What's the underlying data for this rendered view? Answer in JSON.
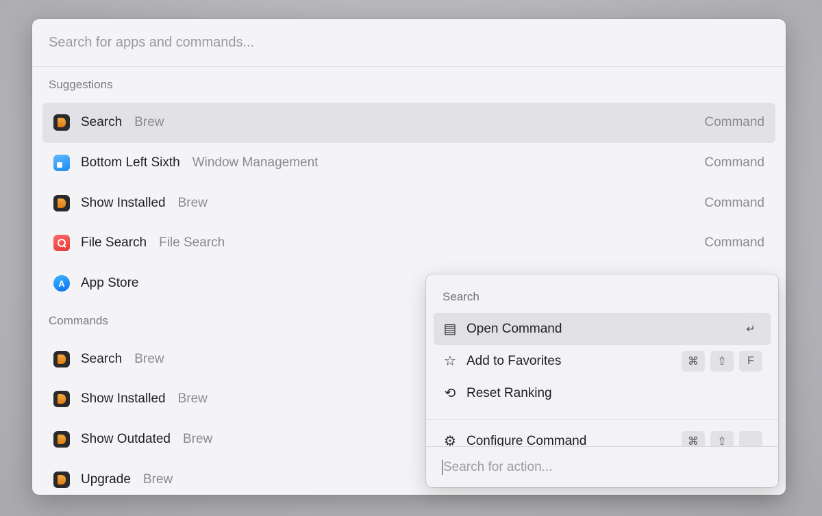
{
  "search": {
    "placeholder": "Search for apps and commands..."
  },
  "suggestions": {
    "title": "Suggestions",
    "items": [
      {
        "title": "Search",
        "subtitle": "Brew",
        "accessory": "Command",
        "icon": "brew-icon"
      },
      {
        "title": "Bottom Left Sixth",
        "subtitle": "Window Management",
        "accessory": "Command",
        "icon": "window-management-icon"
      },
      {
        "title": "Show Installed",
        "subtitle": "Brew",
        "accessory": "Command",
        "icon": "brew-icon"
      },
      {
        "title": "File Search",
        "subtitle": "File Search",
        "accessory": "Command",
        "icon": "file-search-icon"
      },
      {
        "title": "App Store",
        "subtitle": "",
        "accessory": "",
        "icon": "app-store-icon",
        "glyph": "A"
      }
    ]
  },
  "commands": {
    "title": "Commands",
    "items": [
      {
        "title": "Search",
        "subtitle": "Brew",
        "icon": "brew-icon"
      },
      {
        "title": "Show Installed",
        "subtitle": "Brew",
        "icon": "brew-icon"
      },
      {
        "title": "Show Outdated",
        "subtitle": "Brew",
        "icon": "brew-icon"
      },
      {
        "title": "Upgrade",
        "subtitle": "Brew",
        "icon": "brew-icon"
      }
    ]
  },
  "action_panel": {
    "title": "Search",
    "actions": [
      {
        "label": "Open Command",
        "icon": "list-icon",
        "glyph": "▤",
        "keys": [
          "↵"
        ]
      },
      {
        "label": "Add to Favorites",
        "icon": "star-icon",
        "glyph": "☆",
        "keys": [
          "⌘",
          "⇧",
          "F"
        ]
      },
      {
        "label": "Reset Ranking",
        "icon": "reset-icon",
        "glyph": "⟲",
        "keys": []
      }
    ],
    "partial_action": {
      "label": "Configure Command",
      "icon": "gear-icon",
      "glyph": "⚙",
      "keys": [
        "⌘",
        "⇧",
        ""
      ]
    },
    "search_placeholder": "Search for action..."
  }
}
